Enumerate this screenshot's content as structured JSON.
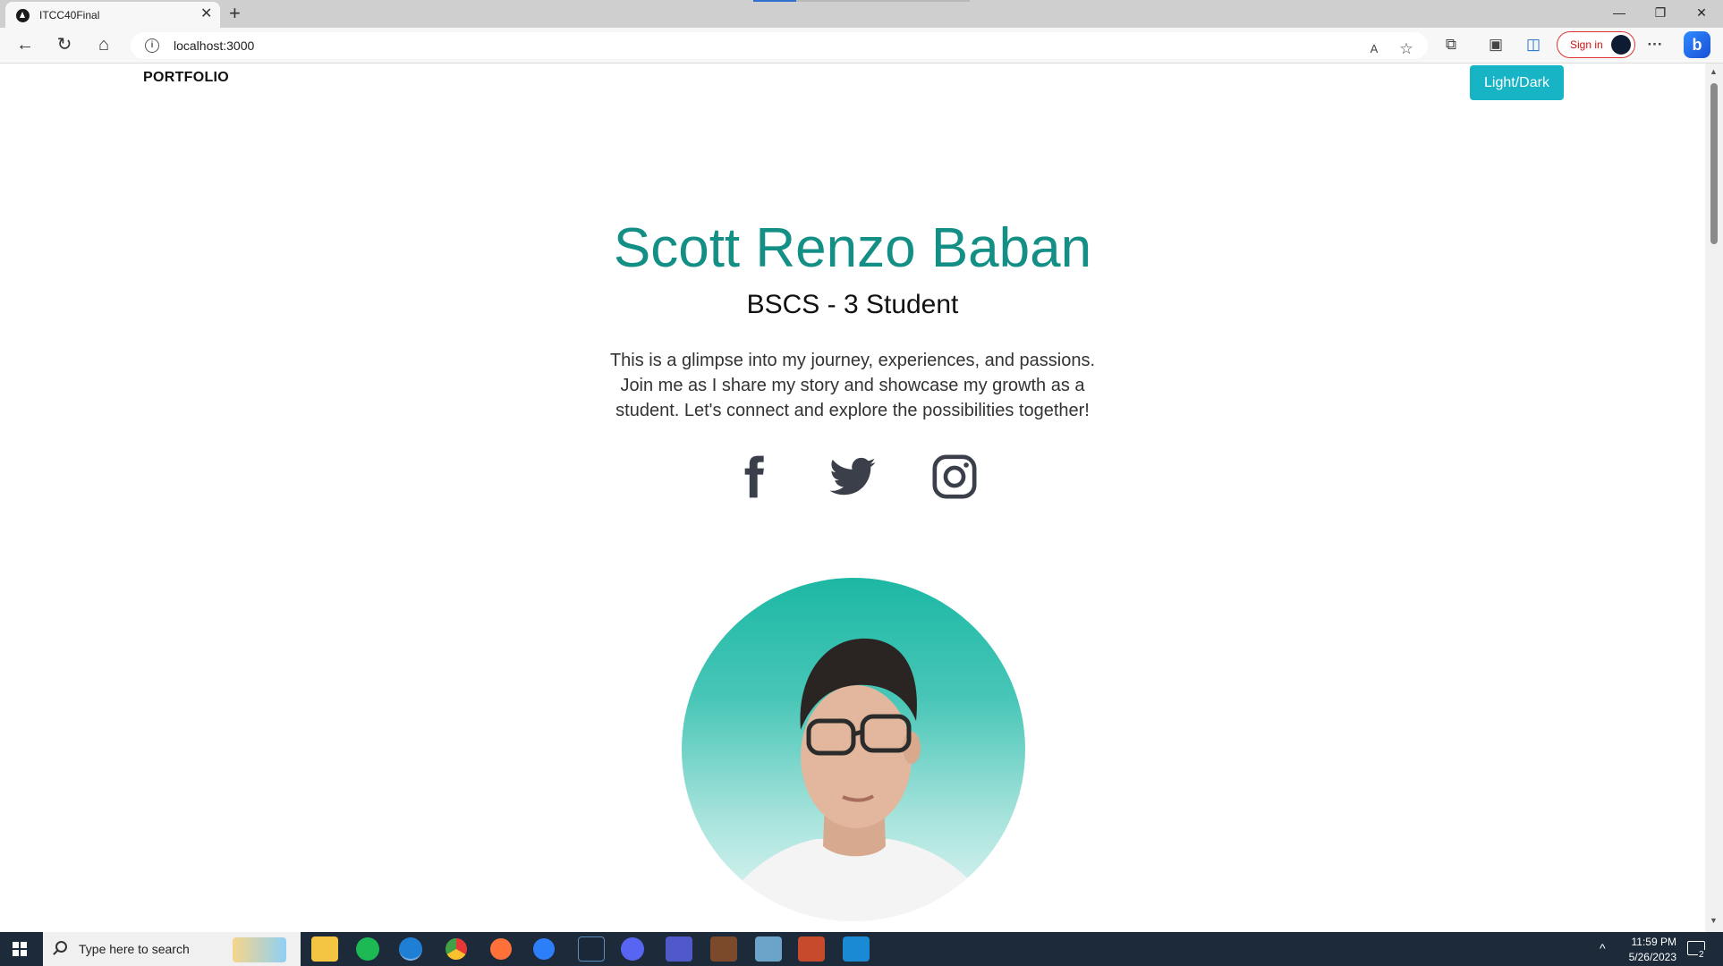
{
  "browser": {
    "tab_title": "ITCC40Final",
    "tab_close_icon": "close-icon",
    "new_tab_icon": "plus-icon",
    "url": "localhost:3000",
    "signin_label": "Sign in",
    "bing_label": "b",
    "window_controls": [
      "minimize-icon",
      "restore-icon",
      "close-icon"
    ]
  },
  "page": {
    "brand": "PORTFOLIO",
    "theme_toggle": "Light/Dark",
    "hero_name": "Scott Renzo Baban",
    "hero_subtitle": "BSCS - 3 Student",
    "hero_description": "This is a glimpse into my journey, experiences, and passions. Join me as I share my story and showcase my growth as a student. Let's connect and explore the possibilities together!",
    "socials": [
      "facebook-icon",
      "twitter-icon",
      "instagram-icon"
    ],
    "accent_color": "#138f86",
    "button_color": "#17b4c6"
  },
  "taskbar": {
    "search_placeholder": "Type here to search",
    "apps": [
      "file-explorer-icon",
      "spotify-icon",
      "edge-icon",
      "chrome-icon",
      "firefox-icon",
      "app-icon",
      "steam-icon",
      "discord-icon",
      "teams-icon",
      "app-icon",
      "app-icon",
      "app-icon",
      "vscode-icon"
    ],
    "time": "11:59 PM",
    "date": "5/26/2023",
    "notification_count": "2"
  }
}
